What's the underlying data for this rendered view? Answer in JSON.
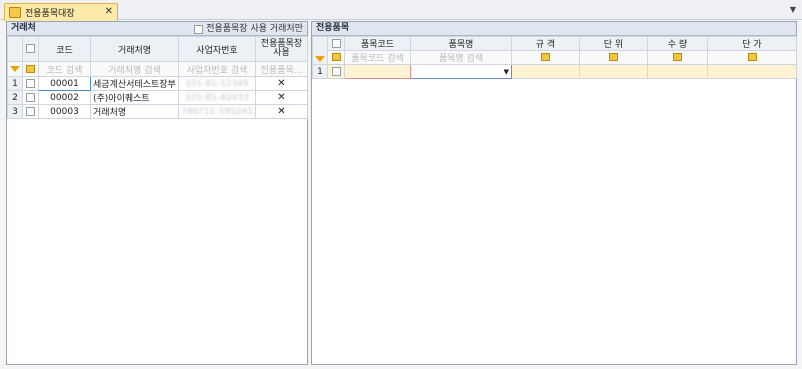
{
  "tab": {
    "label": "전용품목대장",
    "close": "✕",
    "menu": "▼"
  },
  "left": {
    "title": "거래처",
    "option_label": "전용품목장 사용 거래처만",
    "columns": [
      "코드",
      "거래처명",
      "사업자번호",
      "전용품목장\n사용"
    ],
    "filters": [
      "코드 검색",
      "거래처명 검색",
      "사업자번호 검색",
      "전용품목..."
    ],
    "rows": [
      {
        "num": "1",
        "code": "00001",
        "name": "세금계산서테스트장부",
        "biz": "101-81-12345",
        "use": "✕"
      },
      {
        "num": "2",
        "code": "00002",
        "name": "(주)아이퀘스트",
        "biz": "101-81-42433",
        "use": "✕"
      },
      {
        "num": "3",
        "code": "00003",
        "name": "거래처명",
        "biz": "746711-1952413",
        "use": "✕"
      }
    ]
  },
  "right": {
    "title": "전용품목",
    "columns": [
      "품목코드",
      "품목명",
      "규 격",
      "단 위",
      "수 량",
      "단 가"
    ],
    "filters": [
      "품목코드 검색",
      "품목명 검색"
    ],
    "rows": [
      {
        "num": "1"
      }
    ]
  }
}
